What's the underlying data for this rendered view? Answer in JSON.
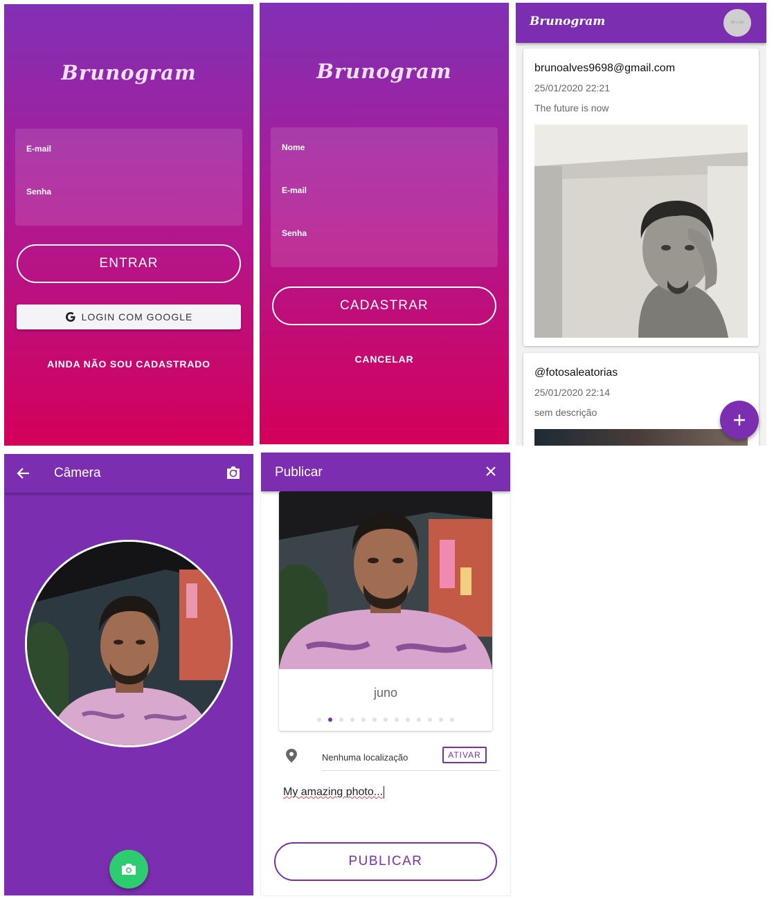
{
  "login": {
    "logo": "Brunogram",
    "email_label": "E-mail",
    "password_label": "Senha",
    "enter_button": "ENTRAR",
    "google_button": "LOGIN COM GOOGLE",
    "register_link": "AINDA NÃO SOU CADASTRADO"
  },
  "register": {
    "logo": "Brunogram",
    "name_label": "Nome",
    "email_label": "E-mail",
    "password_label": "Senha",
    "register_button": "CADASTRAR",
    "cancel_button": "CANCELAR"
  },
  "feed": {
    "title": "Brunogram",
    "avatar_text": "80 x 80",
    "posts": [
      {
        "user": "brunoalves9698@gmail.com",
        "date": "25/01/2020 22:21",
        "description": "The future is now"
      },
      {
        "user": "@fotosaleatorias",
        "date": "25/01/2020 22:14",
        "description": "sem descrição"
      }
    ]
  },
  "camera": {
    "title": "Câmera"
  },
  "publish": {
    "title": "Publicar",
    "filter_name": "juno",
    "filter_count": 13,
    "filter_active_index": 1,
    "location_text": "Nenhuma localização",
    "activate_button": "ATIVAR",
    "caption": "My amazing photo...",
    "publish_button": "PUBLICAR"
  },
  "colors": {
    "primary": "#7b2fb0",
    "accent_green": "#2ecc71",
    "gradient_top": "#8130b5",
    "gradient_bottom": "#d4005a"
  }
}
